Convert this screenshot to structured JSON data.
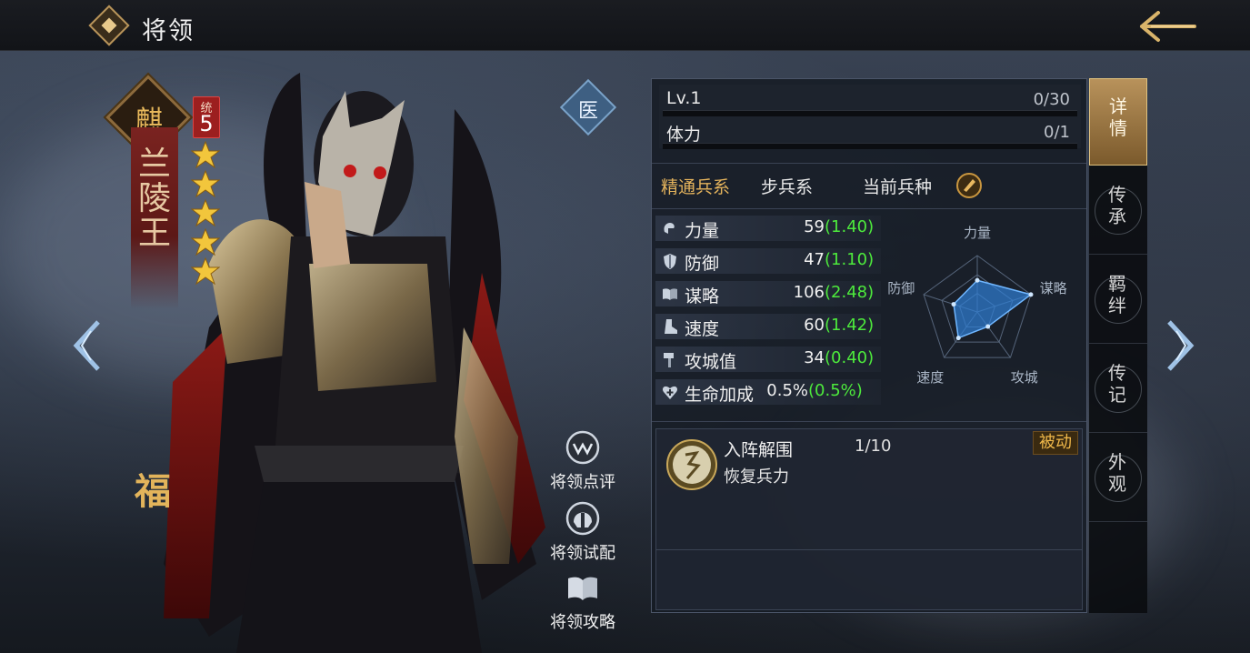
{
  "header": {
    "title": "将领"
  },
  "hero": {
    "name": "兰陵王",
    "emblem_glyph": "麒",
    "command_label": "统",
    "command_value": "5",
    "stars": 5,
    "rarity_mark": "福",
    "medic_badge": "医"
  },
  "actions": [
    {
      "label": "将领点评",
      "icon": "comment-icon"
    },
    {
      "label": "将领试配",
      "icon": "helmet-icon"
    },
    {
      "label": "将领攻略",
      "icon": "book-icon"
    }
  ],
  "level": {
    "label": "Lv.1",
    "value": "0/30",
    "progress": 0
  },
  "stamina": {
    "label": "体力",
    "value": "0/1",
    "progress": 0
  },
  "mastery": {
    "title": "精通兵系",
    "value": "步兵系",
    "current_troop_label": "当前兵种"
  },
  "stats": [
    {
      "name": "力量",
      "value": "59",
      "growth": "(1.40)",
      "icon": "fist-icon"
    },
    {
      "name": "防御",
      "value": "47",
      "growth": "(1.10)",
      "icon": "shield-icon"
    },
    {
      "name": "谋略",
      "value": "106",
      "growth": "(2.48)",
      "icon": "book-icon"
    },
    {
      "name": "速度",
      "value": "60",
      "growth": "(1.42)",
      "icon": "boot-icon"
    },
    {
      "name": "攻城值",
      "value": "34",
      "growth": "(0.40)",
      "icon": "hammer-icon"
    },
    {
      "name": "生命加成",
      "value": "0.5%",
      "growth": "(0.5%)",
      "icon": "heart-cross-icon"
    }
  ],
  "radar": {
    "axes": [
      "力量",
      "谋略",
      "攻城",
      "速度",
      "防御"
    ],
    "values": [
      0.56,
      1.0,
      0.32,
      0.57,
      0.44
    ],
    "fill_color": "#2f7fd6",
    "stroke_color": "#6fb6ff"
  },
  "skill": {
    "name": "入阵解围",
    "level": "1/10",
    "description": "恢复兵力",
    "type": "被动"
  },
  "tabs": [
    {
      "label": "详情",
      "active": true
    },
    {
      "label": "传承",
      "active": false
    },
    {
      "label": "羁绊",
      "active": false
    },
    {
      "label": "传记",
      "active": false
    },
    {
      "label": "外观",
      "active": false
    }
  ],
  "colors": {
    "accent_gold": "#e4b35c",
    "growth_green": "#4dea3c",
    "tab_active": "#b8925b"
  }
}
